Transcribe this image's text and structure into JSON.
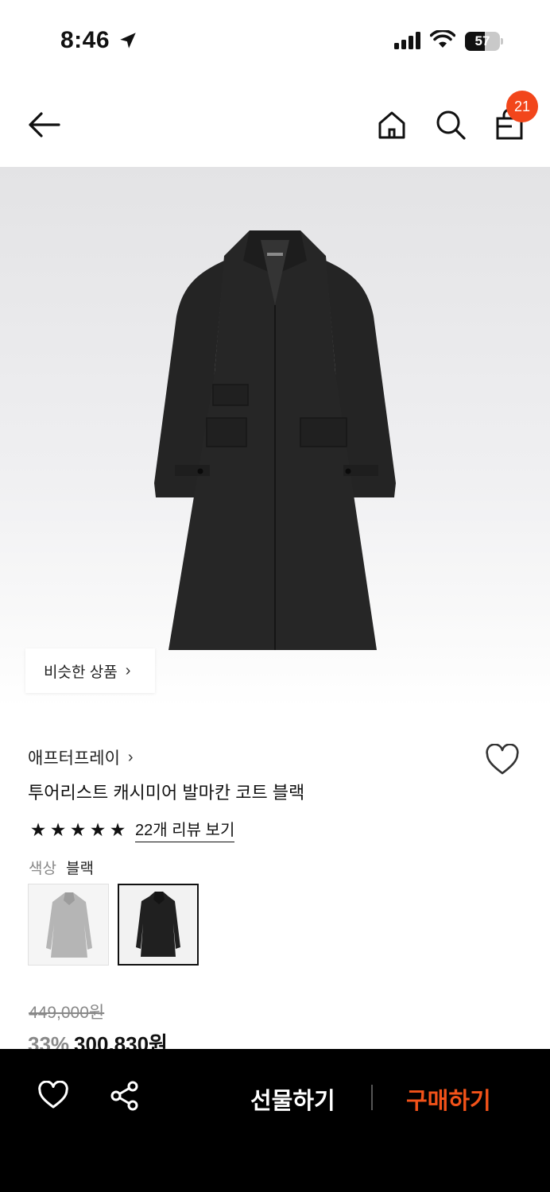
{
  "status_bar": {
    "time": "8:46",
    "battery": "57",
    "battery_level": 0.57
  },
  "header": {
    "cart_count": "21"
  },
  "hero": {
    "similar_label": "비슷한 상품"
  },
  "product": {
    "brand": "애프터프레이",
    "name": "투어리스트 캐시미어 발마칸 코트 블랙",
    "rating": 5,
    "stars": [
      "★",
      "★",
      "★",
      "★",
      "★"
    ],
    "review_link": "22개 리뷰 보기",
    "color_label": "색상",
    "color_value": "블랙",
    "original_price": "449,000원",
    "discount": "33%",
    "sale_price": "300,830원"
  },
  "bottom_bar": {
    "gift_label": "선물하기",
    "buy_label": "구매하기"
  },
  "colors": {
    "accent": "#f25219",
    "badge": "#f2461b",
    "bar_bg": "#000000"
  }
}
